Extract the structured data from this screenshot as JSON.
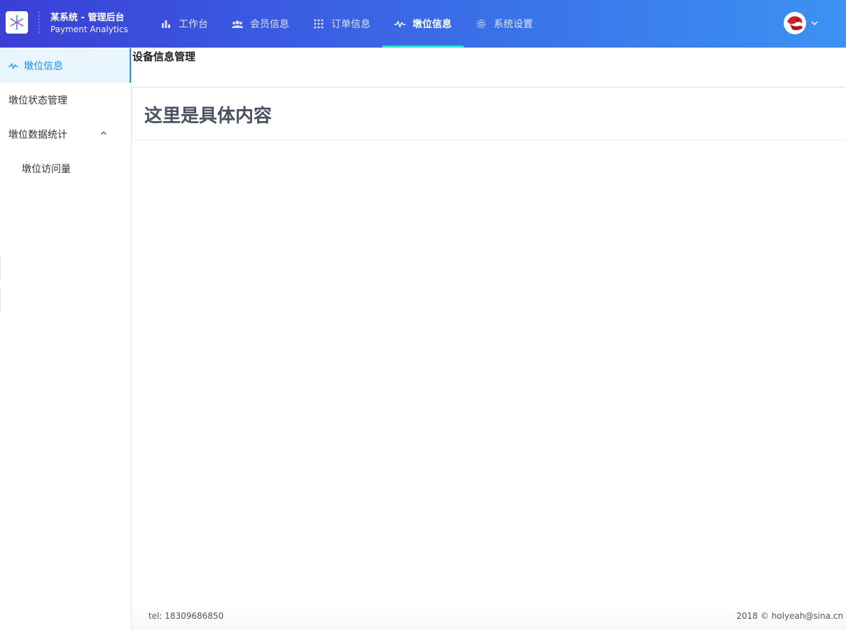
{
  "header": {
    "brand_title": "某系统 - 管理后台",
    "brand_subtitle": "Payment Analytics",
    "nav": [
      {
        "label": "工作台",
        "icon": "bar-chart-icon"
      },
      {
        "label": "会员信息",
        "icon": "users-icon"
      },
      {
        "label": "订单信息",
        "icon": "grid-icon"
      },
      {
        "label": "墩位信息",
        "icon": "pulse-icon",
        "active": true
      },
      {
        "label": "系统设置",
        "icon": "gear-icon"
      }
    ],
    "accent_color": "#2ee6c8"
  },
  "sidebar": {
    "items": [
      {
        "label": "墩位信息",
        "icon": "pulse-icon",
        "active": true
      },
      {
        "label": "墩位状态管理"
      },
      {
        "label": "墩位数据统计",
        "expanded": true
      },
      {
        "label": "墩位访问量"
      }
    ],
    "active_color": "#1890ff"
  },
  "main": {
    "page_title": "设备信息管理",
    "content_text": "这里是具体内容"
  },
  "footer": {
    "left": "tel: 18309686850",
    "right": "2018 © holyeah@sina.cn"
  }
}
